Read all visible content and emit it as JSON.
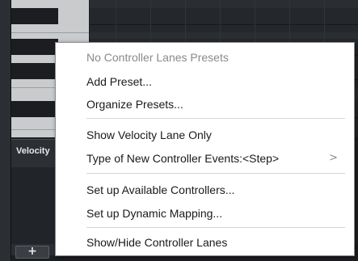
{
  "lane": {
    "label": "Velocity"
  },
  "add_button": {
    "label": "+"
  },
  "menu": {
    "items": [
      {
        "label": "No Controller Lanes Presets",
        "disabled": true
      },
      {
        "label": "Add Preset..."
      },
      {
        "label": "Organize Presets..."
      },
      {
        "label": "Show Velocity Lane Only"
      },
      {
        "label": "Type of New Controller Events:<Step>",
        "submenu_arrow": ">"
      },
      {
        "label": "Set up Available Controllers..."
      },
      {
        "label": "Set up Dynamic Mapping..."
      },
      {
        "label": "Show/Hide Controller Lanes"
      }
    ]
  },
  "colors": {
    "menu_background": "#ffffff",
    "disabled_text": "#8a8a8a",
    "editor_background": "#1c1f22",
    "keyboard_white": "#c9cbcd",
    "keyboard_black": "#1b1d20"
  }
}
